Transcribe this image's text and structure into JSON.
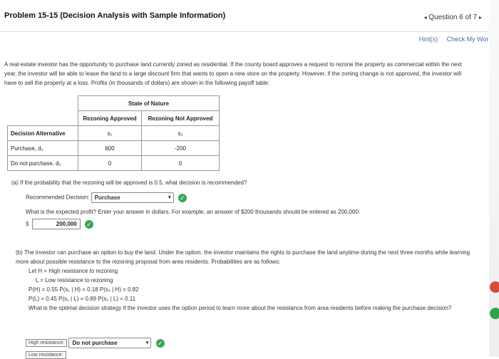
{
  "header": {
    "title": "Problem 15-15 (Decision Analysis with Sample Information)",
    "question_nav": "Question 6 of 7",
    "prev_arrow": "◂",
    "next_arrow": "▸"
  },
  "hint_bar": {
    "hints": "Hint(s)",
    "check": "Check My Work"
  },
  "intro": "A real estate investor has the opportunity to purchase land currently zoned as residential. If the county board approves a request to rezone the property as commercial within the next year, the investor will be able to lease the land to a large discount firm that wants to open a new store on the property. However, if the zoning change is not approved, the investor will have to sell the property at a loss. Profits (in thousands of dollars) are shown in the following payoff table:",
  "table": {
    "state_of_nature": "State of Nature",
    "col1": "Rezoning Approved",
    "col2": "Rezoning Not Approved",
    "decision_header": "Decision Alternative",
    "s1": "s₁",
    "s2": "s₂",
    "rows": [
      {
        "label": "Purchase, d₁",
        "v1": "600",
        "v2": "-200"
      },
      {
        "label": "Do not purchase, d₂",
        "v1": "0",
        "v2": "0"
      }
    ]
  },
  "part_a": {
    "question": "(a) If the probability that the rezoning will be approved is 0.5, what decision is recommended?",
    "rec_label": "Recommended Decision:",
    "rec_value": "Purchase",
    "exp_question": "What is the expected profit? Enter your answer in dollars. For example, an answer of $200 thousands should be entered as 200,000.",
    "dollar": "$",
    "answer": "200,000"
  },
  "part_b": {
    "intro": "(b) The investor can purchase an option to buy the land. Under the option, the investor maintains the rights to purchase the land anytime during the next three months while learning more about possible resistance to the rezoning proposal from area residents. Probabilities are as follows:",
    "line1": "Let H = High resistance to rezoning",
    "line2": "L = Low resistance to rezoning",
    "line3": "P(H) = 0.55   P(s₁ | H) = 0.18   P(s₂ | H) = 0.82",
    "line4": "P(L) = 0.45   P(s₁ | L) = 0.89   P(s₂ | L) = 0.11",
    "question": "What is the optimal decision strategy if the investor uses the option period to learn more about the resistance from area residents before making the purchase decision?",
    "high_label": "High resistance:",
    "high_value": "Do not purchase",
    "low_label": "Low resistance:"
  }
}
